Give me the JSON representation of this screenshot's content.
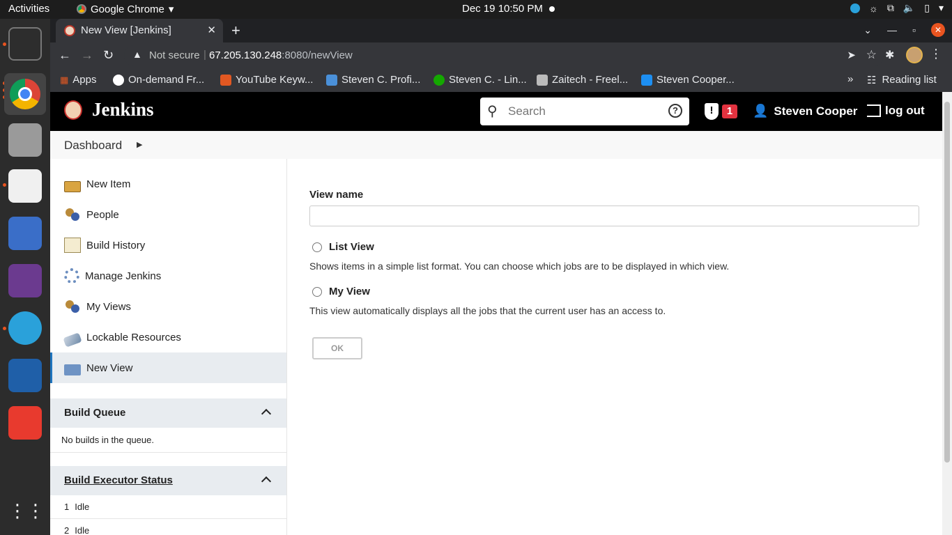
{
  "topbar": {
    "activities": "Activities",
    "app_name": "Google Chrome",
    "clock": "Dec 19  10:50 PM"
  },
  "browser": {
    "tab_title": "New View [Jenkins]",
    "omnibox": {
      "security_label": "Not secure",
      "separator": "|",
      "host": "67.205.130.248",
      "path": ":8080/newView"
    },
    "bookmarks": [
      {
        "label": "Apps",
        "color": "#e8eaed"
      },
      {
        "label": "On-demand Fr...",
        "color": "#ffffff"
      },
      {
        "label": "YouTube Keyw...",
        "color": "#e25822"
      },
      {
        "label": "Steven C. Profi...",
        "color": "#4a90d9"
      },
      {
        "label": "Steven C. - Lin...",
        "color": "#14a800"
      },
      {
        "label": "Zaitech - Freel...",
        "color": "#bbbbbb"
      },
      {
        "label": "Steven Cooper...",
        "color": "#1d8ff2"
      }
    ],
    "reading_list": "Reading list"
  },
  "jenkins": {
    "brand": "Jenkins",
    "search_placeholder": "Search",
    "alert_count": "1",
    "user": "Steven Cooper",
    "logout": "log out",
    "breadcrumb": "Dashboard",
    "tasks": [
      {
        "label": "New Item",
        "icon": "new-item-icon"
      },
      {
        "label": "People",
        "icon": "people-icon"
      },
      {
        "label": "Build History",
        "icon": "notepad-icon"
      },
      {
        "label": "Manage Jenkins",
        "icon": "gear-icon"
      },
      {
        "label": "My Views",
        "icon": "people-icon"
      },
      {
        "label": "Lockable Resources",
        "icon": "lock-icon"
      },
      {
        "label": "New View",
        "icon": "folder-icon"
      }
    ],
    "build_queue": {
      "title": "Build Queue",
      "empty_text": "No builds in the queue."
    },
    "executor_status": {
      "title": "Build Executor Status",
      "executors": [
        {
          "num": "1",
          "state": "Idle"
        },
        {
          "num": "2",
          "state": "Idle"
        }
      ]
    },
    "form": {
      "view_name_label": "View name",
      "view_name_value": "",
      "options": [
        {
          "label": "List View",
          "description": "Shows items in a simple list format. You can choose which jobs are to be displayed in which view."
        },
        {
          "label": "My View",
          "description": "This view automatically displays all the jobs that the current user has an access to."
        }
      ],
      "ok_label": "OK"
    }
  }
}
